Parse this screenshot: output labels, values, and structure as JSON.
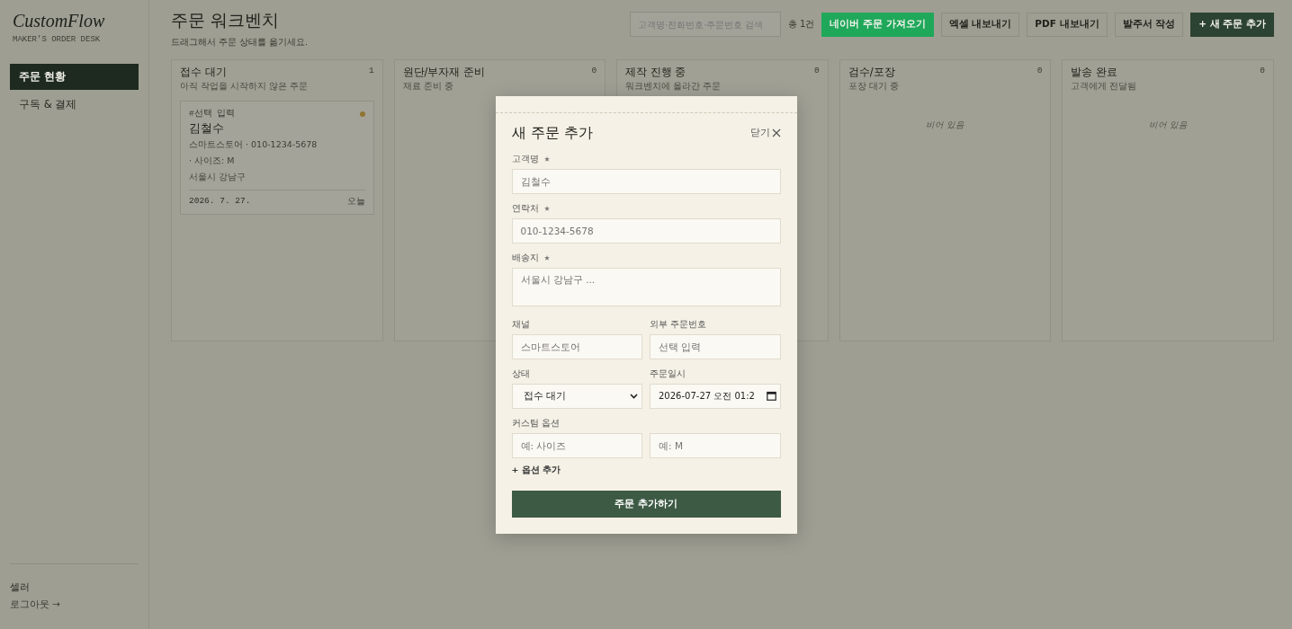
{
  "sidebar": {
    "logo": "CustomFlow",
    "tagline": "MAKER'S ORDER DESK",
    "items": [
      {
        "label": "주문 현황",
        "selected": true
      },
      {
        "label": "구독 & 결제",
        "selected": false
      }
    ],
    "user": "셀러",
    "logout": "로그아웃 →"
  },
  "header": {
    "title": "주문 워크벤치",
    "subtitle": "드래그해서 주문 상태를 옮기세요.",
    "search_placeholder": "고객명·전화번호·주문번호 검색",
    "total": "총 1건",
    "buttons": [
      {
        "label": "네이버 주문 가져오기",
        "kind": "naver"
      },
      {
        "label": "엑셀 내보내기",
        "kind": "plain"
      },
      {
        "label": "PDF 내보내기",
        "kind": "plain"
      },
      {
        "label": "발주서 작성",
        "kind": "plain"
      },
      {
        "label": "+ 새 주문 추가",
        "kind": "primary"
      }
    ]
  },
  "columns": [
    {
      "title": "접수 대기",
      "subtitle": "아직 작업을 시작하지 않은 주문",
      "count": "1",
      "cards": [
        {
          "tag": "#선택 입력",
          "color": "#8f7431",
          "name": "김철수",
          "contact": "스마트스토어 · 010-1234-5678",
          "option": "· 사이즈: M",
          "address": "서울시 강남구",
          "date": "2026. 7. 27.",
          "when": "오늘"
        }
      ]
    },
    {
      "title": "원단/부자재 준비",
      "subtitle": "재료 준비 중",
      "count": "0"
    },
    {
      "title": "제작 진행 중",
      "subtitle": "워크벤치에 올라간 주문",
      "count": "0"
    },
    {
      "title": "검수/포장",
      "subtitle": "포장 대기 중",
      "count": "0",
      "empty": "비어 있음"
    },
    {
      "title": "발송 완료",
      "subtitle": "고객에게 전달됨",
      "count": "0",
      "empty": "비어 있음"
    }
  ],
  "modal": {
    "title": "새 주문 추가",
    "close": "닫기",
    "fields": [
      {
        "label": "고객명",
        "required": true,
        "placeholder": "김철수",
        "kind": "input"
      },
      {
        "label": "연락처",
        "required": true,
        "placeholder": "010-1234-5678",
        "kind": "input"
      },
      {
        "label": "배송지",
        "required": true,
        "placeholder": "서울시 강남구 ...",
        "kind": "textarea"
      }
    ],
    "pairs": [
      [
        {
          "label": "채널",
          "placeholder": "스마트스토어",
          "kind": "input"
        },
        {
          "label": "외부 주문번호",
          "placeholder": "선택 입력",
          "kind": "input"
        }
      ],
      [
        {
          "label": "상태",
          "value": "접수 대기",
          "kind": "select"
        },
        {
          "label": "주문일시",
          "value": "2026-07-27 오전 01:2",
          "kind": "datetime"
        }
      ]
    ],
    "options_label": "커스텀 옵션",
    "option_placeholders": [
      "예: 사이즈",
      "예: M"
    ],
    "add_option": "+ 옵션 추가",
    "submit": "주문 추가하기"
  }
}
